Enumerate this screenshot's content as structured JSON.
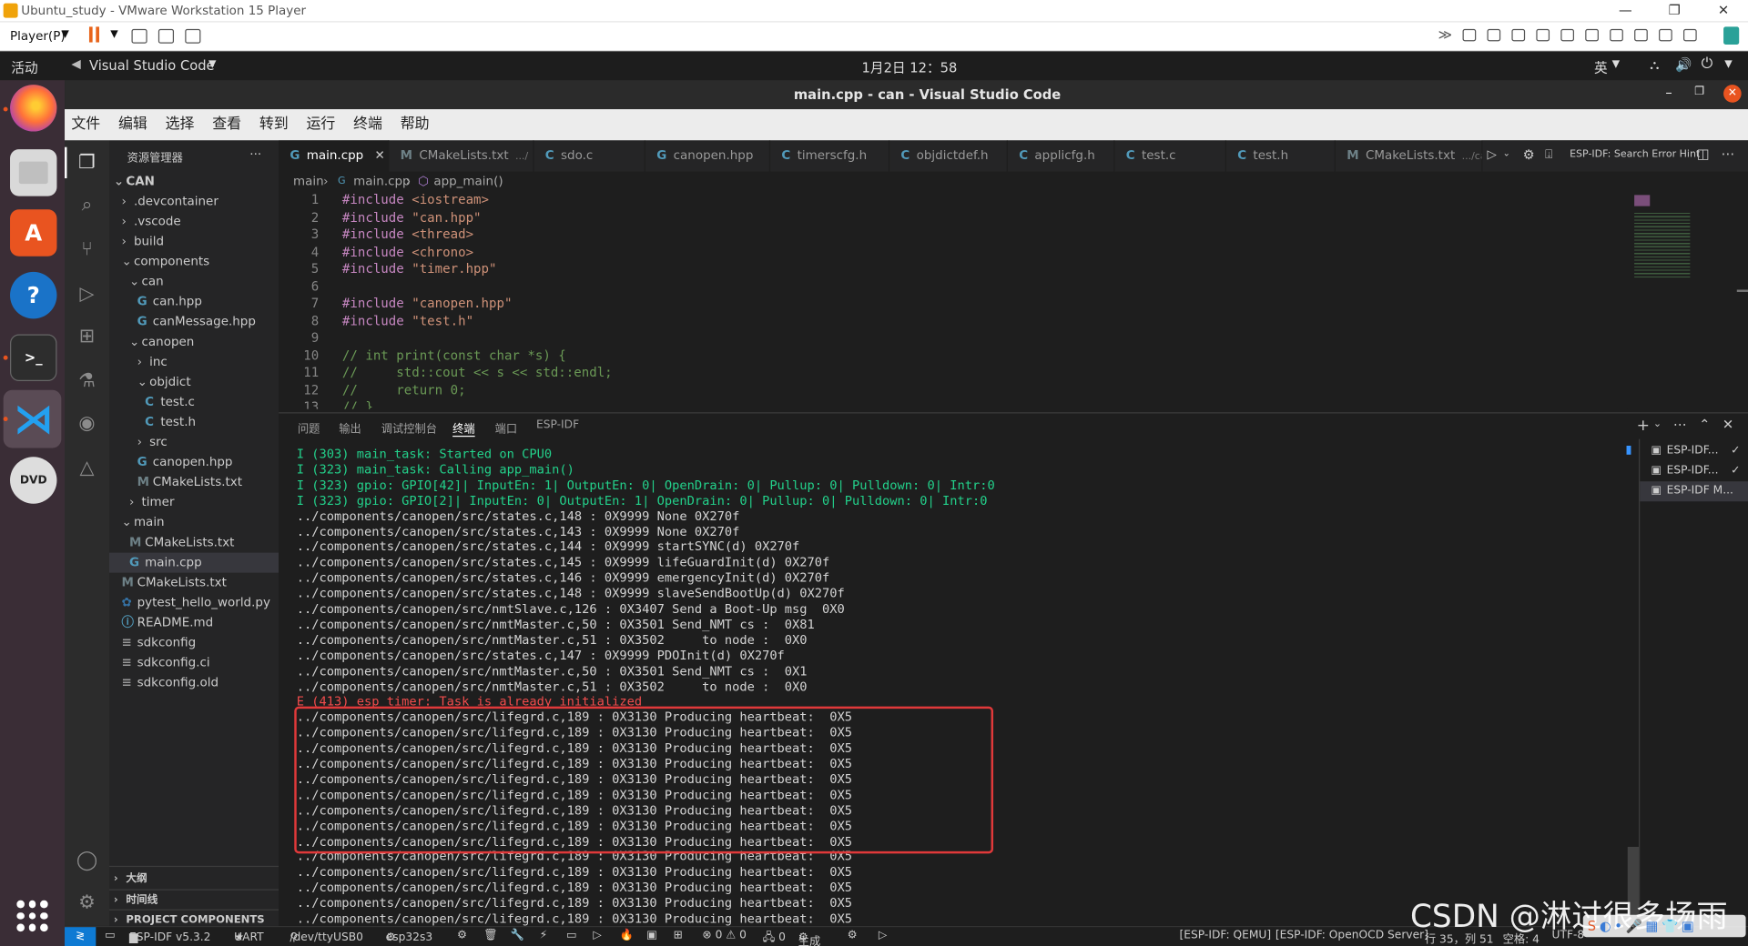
{
  "vmware": {
    "title": "Ubuntu_study - VMware Workstation 15 Player",
    "player_menu": "Player(P)",
    "window_controls": [
      "—",
      "❐",
      "✕"
    ]
  },
  "gnome": {
    "activities": "活动",
    "app": "Visual Studio Code",
    "clock": "1月2日  12：58",
    "ime": "英"
  },
  "vscode": {
    "title": "main.cpp - can - Visual Studio Code",
    "menu": [
      "文件",
      "编辑",
      "选择",
      "查看",
      "转到",
      "运行",
      "终端",
      "帮助"
    ],
    "explorer_title": "资源管理器",
    "explorer_more": "···",
    "tree": [
      {
        "label": "CAN",
        "depth": 0,
        "kind": "folder-open"
      },
      {
        "label": ".devcontainer",
        "depth": 1,
        "kind": "folder"
      },
      {
        "label": ".vscode",
        "depth": 1,
        "kind": "folder"
      },
      {
        "label": "build",
        "depth": 1,
        "kind": "folder"
      },
      {
        "label": "components",
        "depth": 1,
        "kind": "folder-open"
      },
      {
        "label": "can",
        "depth": 2,
        "kind": "folder-open"
      },
      {
        "label": "can.hpp",
        "depth": 3,
        "kind": "cpp"
      },
      {
        "label": "canMessage.hpp",
        "depth": 3,
        "kind": "cpp"
      },
      {
        "label": "canopen",
        "depth": 2,
        "kind": "folder-open"
      },
      {
        "label": "inc",
        "depth": 3,
        "kind": "folder"
      },
      {
        "label": "objdict",
        "depth": 3,
        "kind": "folder-open"
      },
      {
        "label": "test.c",
        "depth": 4,
        "kind": "c"
      },
      {
        "label": "test.h",
        "depth": 4,
        "kind": "c"
      },
      {
        "label": "src",
        "depth": 3,
        "kind": "folder"
      },
      {
        "label": "canopen.hpp",
        "depth": 3,
        "kind": "cpp"
      },
      {
        "label": "CMakeLists.txt",
        "depth": 3,
        "kind": "cmake"
      },
      {
        "label": "timer",
        "depth": 2,
        "kind": "folder"
      },
      {
        "label": "main",
        "depth": 1,
        "kind": "folder-open"
      },
      {
        "label": "CMakeLists.txt",
        "depth": 2,
        "kind": "cmake"
      },
      {
        "label": "main.cpp",
        "depth": 2,
        "kind": "cpp",
        "selected": true
      },
      {
        "label": "CMakeLists.txt",
        "depth": 1,
        "kind": "cmake"
      },
      {
        "label": "pytest_hello_world.py",
        "depth": 1,
        "kind": "py"
      },
      {
        "label": "README.md",
        "depth": 1,
        "kind": "info"
      },
      {
        "label": "sdkconfig",
        "depth": 1,
        "kind": "lines"
      },
      {
        "label": "sdkconfig.ci",
        "depth": 1,
        "kind": "lines"
      },
      {
        "label": "sdkconfig.old",
        "depth": 1,
        "kind": "lines"
      }
    ],
    "sections": [
      "大纲",
      "时间线",
      "PROJECT COMPONENTS"
    ],
    "tabs": [
      {
        "icon": "C+",
        "label": "main.cpp",
        "active": true
      },
      {
        "icon": "M",
        "label": "CMakeLists.txt",
        "hint": ".../"
      },
      {
        "icon": "C",
        "label": "sdo.c"
      },
      {
        "icon": "C+",
        "label": "canopen.hpp"
      },
      {
        "icon": "C",
        "label": "timerscfg.h"
      },
      {
        "icon": "C",
        "label": "objdictdef.h"
      },
      {
        "icon": "C",
        "label": "applicfg.h"
      },
      {
        "icon": "C",
        "label": "test.c"
      },
      {
        "icon": "C",
        "label": "test.h"
      },
      {
        "icon": "M",
        "label": "CMakeLists.txt",
        "hint": ".../can"
      }
    ],
    "esp_hint": "ESP-IDF: Search Error Hint",
    "breadcrumb": [
      "main",
      "main.cpp",
      "app_main()"
    ],
    "code": [
      {
        "n": "1",
        "kw": "#include",
        "rest": " <iostream>"
      },
      {
        "n": "2",
        "kw": "#include",
        "rest": " \"can.hpp\""
      },
      {
        "n": "3",
        "kw": "#include",
        "rest": " <thread>"
      },
      {
        "n": "4",
        "kw": "#include",
        "rest": " <chrono>"
      },
      {
        "n": "5",
        "kw": "#include",
        "rest": " \"timer.hpp\""
      },
      {
        "n": "6",
        "kw": "",
        "rest": ""
      },
      {
        "n": "7",
        "kw": "#include",
        "rest": " \"canopen.hpp\""
      },
      {
        "n": "8",
        "kw": "#include",
        "rest": " \"test.h\""
      },
      {
        "n": "9",
        "kw": "",
        "rest": ""
      },
      {
        "n": "10",
        "cm": "// int print(const char *s) {"
      },
      {
        "n": "11",
        "cm": "//     std::cout << s << std::endl;"
      },
      {
        "n": "12",
        "cm": "//     return 0;"
      },
      {
        "n": "13",
        "cm": "// }"
      }
    ],
    "panel_tabs": [
      "问题",
      "输出",
      "调试控制台",
      "终端",
      "端口",
      "ESP-IDF"
    ],
    "panel_active": "终端",
    "terminal": [
      {
        "c": "g",
        "t": "I (303) main_task: Started on CPU0"
      },
      {
        "c": "g",
        "t": "I (323) main_task: Calling app_main()"
      },
      {
        "c": "g",
        "t": "I (323) gpio: GPIO[42]| InputEn: 1| OutputEn: 0| OpenDrain: 0| Pullup: 0| Pulldown: 0| Intr:0"
      },
      {
        "c": "g",
        "t": "I (323) gpio: GPIO[2]| InputEn: 0| OutputEn: 1| OpenDrain: 0| Pullup: 0| Pulldown: 0| Intr:0"
      },
      {
        "c": "w",
        "t": "../components/canopen/src/states.c,148 : 0X9999 None 0X270f"
      },
      {
        "c": "w",
        "t": "../components/canopen/src/states.c,143 : 0X9999 None 0X270f"
      },
      {
        "c": "w",
        "t": "../components/canopen/src/states.c,144 : 0X9999 startSYNC(d) 0X270f"
      },
      {
        "c": "w",
        "t": "../components/canopen/src/states.c,145 : 0X9999 lifeGuardInit(d) 0X270f"
      },
      {
        "c": "w",
        "t": "../components/canopen/src/states.c,146 : 0X9999 emergencyInit(d) 0X270f"
      },
      {
        "c": "w",
        "t": "../components/canopen/src/states.c,148 : 0X9999 slaveSendBootUp(d) 0X270f"
      },
      {
        "c": "w",
        "t": "../components/canopen/src/nmtSlave.c,126 : 0X3407 Send a Boot-Up msg  0X0"
      },
      {
        "c": "w",
        "t": "../components/canopen/src/nmtMaster.c,50 : 0X3501 Send_NMT cs :  0X81"
      },
      {
        "c": "w",
        "t": "../components/canopen/src/nmtMaster.c,51 : 0X3502     to node :  0X0"
      },
      {
        "c": "w",
        "t": "../components/canopen/src/states.c,147 : 0X9999 PDOInit(d) 0X270f"
      },
      {
        "c": "w",
        "t": "../components/canopen/src/nmtMaster.c,50 : 0X3501 Send_NMT cs :  0X1"
      },
      {
        "c": "w",
        "t": "../components/canopen/src/nmtMaster.c,51 : 0X3502     to node :  0X0"
      },
      {
        "c": "r",
        "t": "E (413) esp_timer: Task is already initialized"
      },
      {
        "c": "w",
        "t": "../components/canopen/src/lifegrd.c,189 : 0X3130 Producing heartbeat:  0X5"
      },
      {
        "c": "w",
        "t": "../components/canopen/src/lifegrd.c,189 : 0X3130 Producing heartbeat:  0X5"
      },
      {
        "c": "w",
        "t": "../components/canopen/src/lifegrd.c,189 : 0X3130 Producing heartbeat:  0X5"
      },
      {
        "c": "w",
        "t": "../components/canopen/src/lifegrd.c,189 : 0X3130 Producing heartbeat:  0X5"
      },
      {
        "c": "w",
        "t": "../components/canopen/src/lifegrd.c,189 : 0X3130 Producing heartbeat:  0X5"
      },
      {
        "c": "w",
        "t": "../components/canopen/src/lifegrd.c,189 : 0X3130 Producing heartbeat:  0X5"
      },
      {
        "c": "w",
        "t": "../components/canopen/src/lifegrd.c,189 : 0X3130 Producing heartbeat:  0X5"
      },
      {
        "c": "w",
        "t": "../components/canopen/src/lifegrd.c,189 : 0X3130 Producing heartbeat:  0X5"
      },
      {
        "c": "w",
        "t": "../components/canopen/src/lifegrd.c,189 : 0X3130 Producing heartbeat:  0X5"
      },
      {
        "c": "w",
        "t": "../components/canopen/src/lifegrd.c,189 : 0X3130 Producing heartbeat:  0X5"
      },
      {
        "c": "w",
        "t": "../components/canopen/src/lifegrd.c,189 : 0X3130 Producing heartbeat:  0X5"
      },
      {
        "c": "w",
        "t": "../components/canopen/src/lifegrd.c,189 : 0X3130 Producing heartbeat:  0X5"
      },
      {
        "c": "w",
        "t": "../components/canopen/src/lifegrd.c,189 : 0X3130 Producing heartbeat:  0X5"
      },
      {
        "c": "w",
        "t": "../components/canopen/src/lifegrd.c,189 : 0X3130 Producing heartbeat:  0X5"
      }
    ],
    "terminal_instances": [
      {
        "label": "ESP-IDF...",
        "check": "✓"
      },
      {
        "label": "ESP-IDF...",
        "check": "✓"
      },
      {
        "label": "ESP-IDF M...",
        "check": ""
      }
    ],
    "status": {
      "remote": "≷",
      "esp_idf": "ESP-IDF v5.3.2",
      "uart": "UART",
      "port": "/dev/ttyUSB0",
      "target": "esp32s3",
      "problems": "⊗ 0 ⚠ 0",
      "ports": "🖧 0",
      "build": "生成",
      "qemu": "[ESP-IDF: QEMU]",
      "openocd": "[ESP-IDF: OpenOCD Server]",
      "position": "行 35，列 51",
      "spaces": "空格: 4",
      "encoding": "UTF-8"
    },
    "watermark": "CSDN @淋过很多场雨"
  },
  "colors": {
    "green": "#23d18b",
    "red": "#f14c4c",
    "keyword": "#c586c0",
    "string": "#ce9178",
    "comment": "#6a9955",
    "highlight": "#e0393a"
  }
}
